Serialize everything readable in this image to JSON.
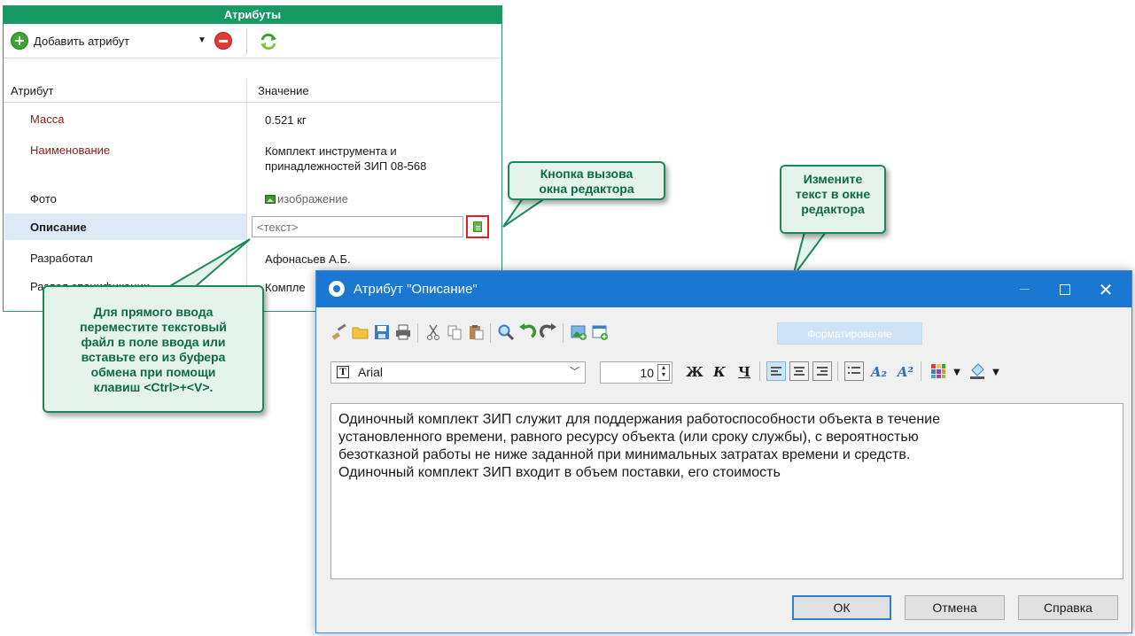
{
  "panel": {
    "title": "Атрибуты",
    "add_label": "Добавить атрибут",
    "columns": {
      "attribute": "Атрибут",
      "value": "Значение"
    },
    "rows": [
      {
        "label": "Масса",
        "value": "0.521 кг"
      },
      {
        "label": "Наименование",
        "value_line1": "Комплект инструмента и",
        "value_line2": "принадлежностей ЗИП 08-568"
      },
      {
        "label": "Фото",
        "value": "изображение"
      },
      {
        "label": "Описание",
        "placeholder": "<текст>"
      },
      {
        "label": "Разработал",
        "value": "Афонасьев А.Б."
      },
      {
        "label": "Раздел спецификации",
        "value": "Компле"
      }
    ]
  },
  "callouts": {
    "editor_button": {
      "line1": "Кнопка вызова",
      "line2": "окна редактора"
    },
    "change_text": {
      "line1": "Измените",
      "line2": "текст в окне",
      "line3": "редактора"
    },
    "direct_input": {
      "line1": "Для прямого ввода",
      "line2": "переместите текстовый",
      "line3": "файл в поле ввода или",
      "line4": "вставьте его из буфера",
      "line5": "обмена при помощи",
      "line6": "клавиш <Ctrl>+<V>."
    }
  },
  "dialog": {
    "title": "Атрибут \"Описание\"",
    "format_tab": "Форматирование",
    "font_name": "Arial",
    "font_size": "10",
    "bold": "Ж",
    "italic": "К",
    "underline": "Ч",
    "subscript": "A₂",
    "superscript": "A²",
    "text_lines": [
      "Одиночный комплект ЗИП служит для поддержания работоспособности объекта в течение",
      "установленного времени, равного ресурсу объекта (или сроку службы), с вероятностью",
      "безотказной работы не ниже заданной при минимальных затратах времени и средств.",
      "Одиночный комплект ЗИП входит в объем поставки, его стоимость"
    ],
    "buttons": {
      "ok": "ОК",
      "cancel": "Отмена",
      "help": "Справка"
    }
  },
  "colors": {
    "panel_header": "#169a63",
    "callout_border": "#1a8a5a",
    "callout_text": "#0d6b43",
    "titlebar": "#1a77d2",
    "highlight_border": "#e0221e"
  }
}
